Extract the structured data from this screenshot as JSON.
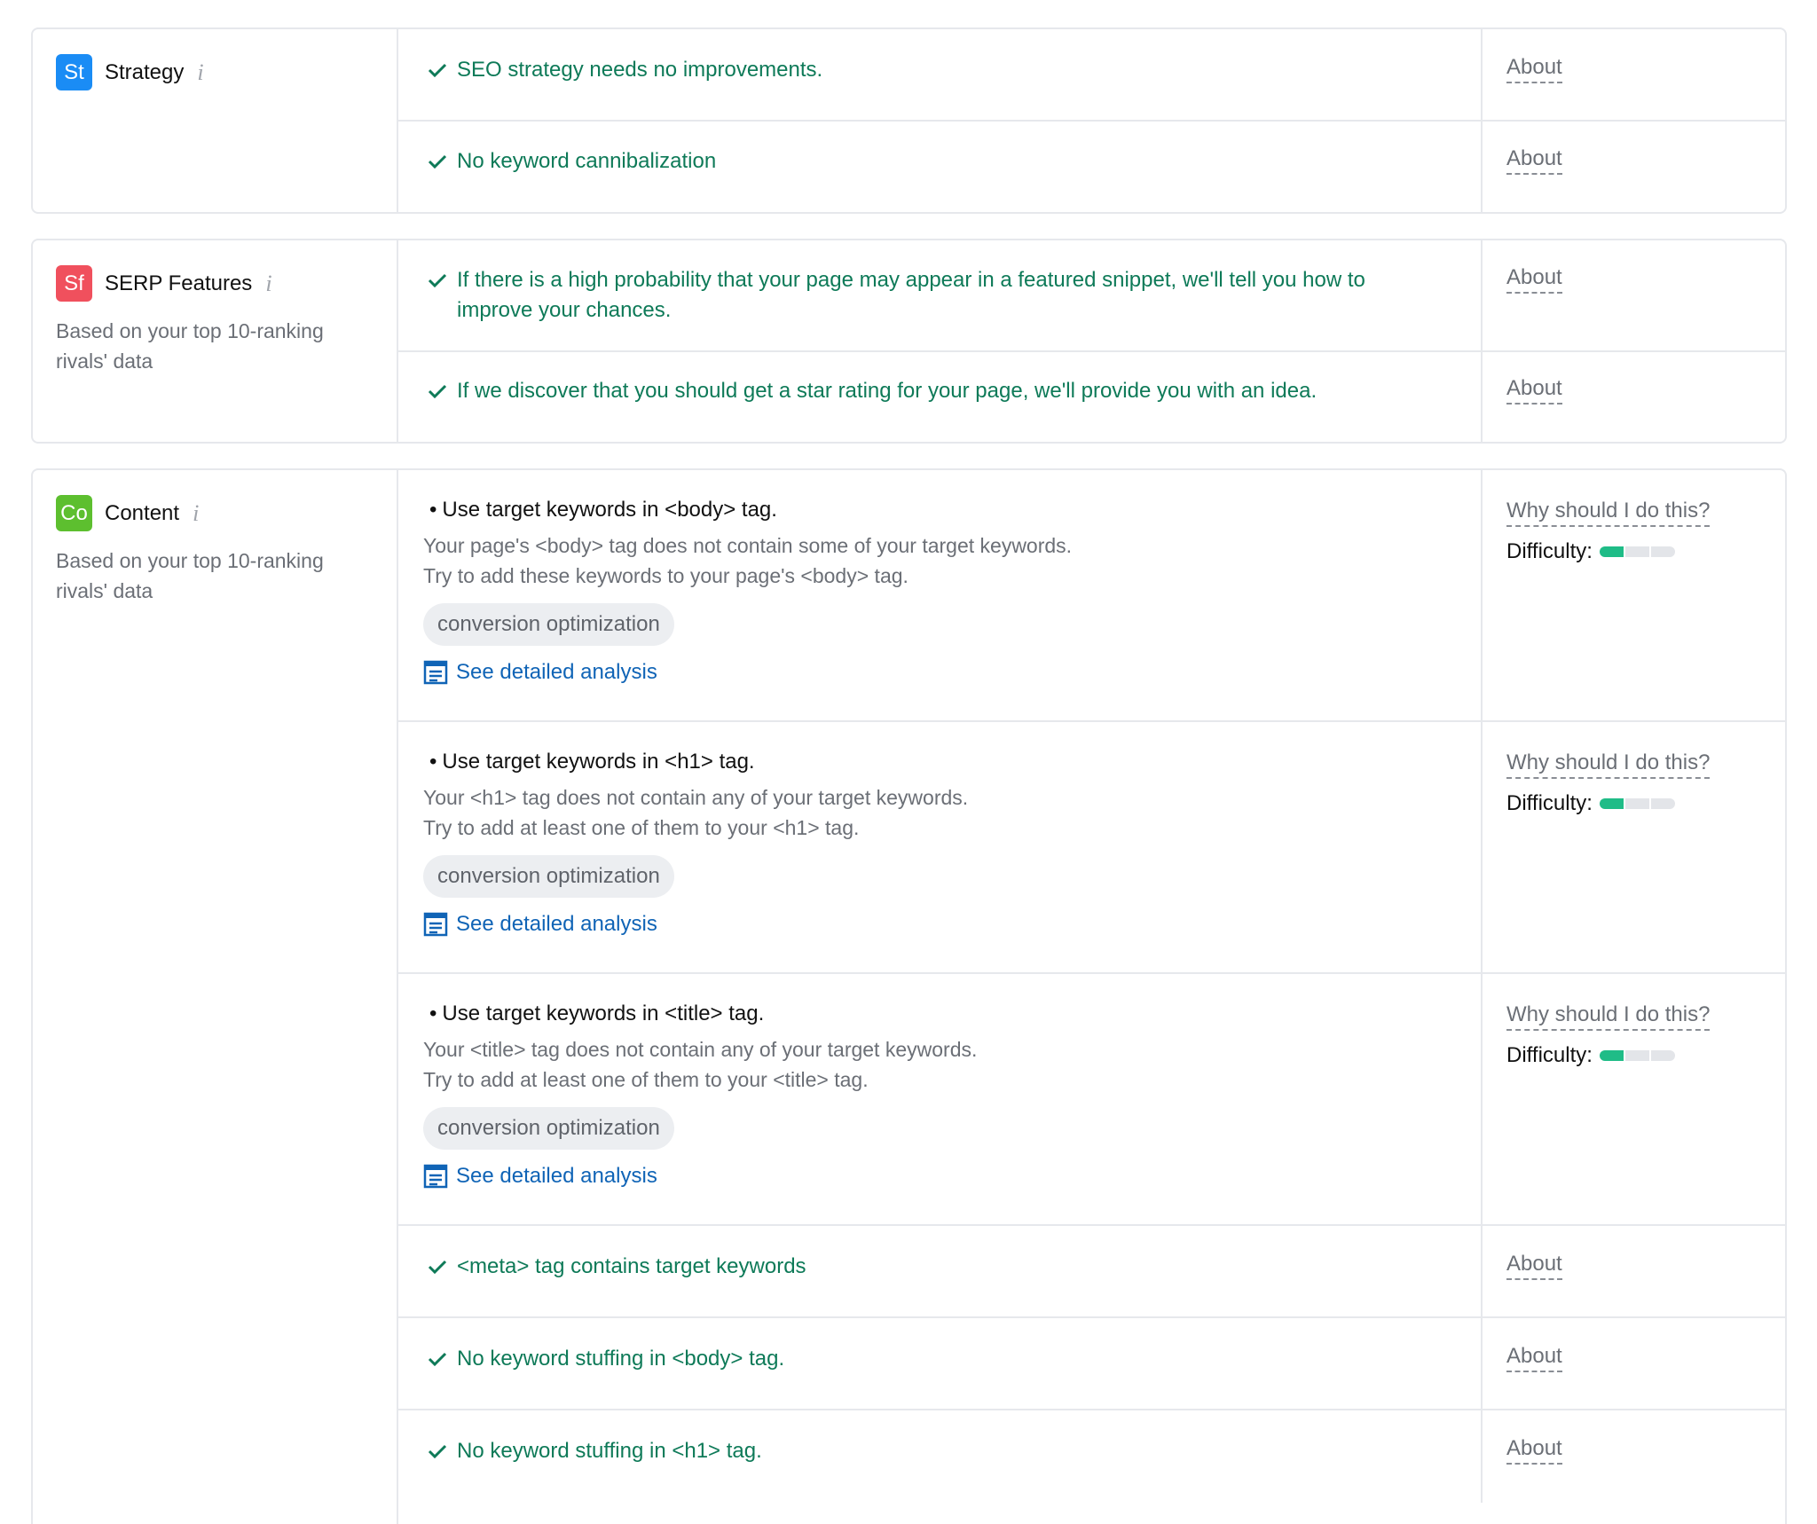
{
  "colors": {
    "strategy_badge": "#1a8cf5",
    "serp_badge": "#f0505d",
    "content_badge": "#5dbf2f",
    "success_text": "#0e7a58",
    "link_blue": "#1064b6",
    "difficulty_fill": "#1fbc87"
  },
  "strategy": {
    "badge": "St",
    "title": "Strategy",
    "info_icon": "i",
    "rows": [
      {
        "text": "SEO strategy needs no improvements.",
        "link": "About"
      },
      {
        "text": "No keyword cannibalization",
        "link": "About"
      }
    ]
  },
  "serp": {
    "badge": "Sf",
    "title": "SERP Features",
    "info_icon": "i",
    "subtitle": "Based on your top 10-ranking rivals' data",
    "rows": [
      {
        "text": "If there is a high probability that your page may appear in a featured snippet, we'll tell you how to improve your chances.",
        "link": "About"
      },
      {
        "text": "If we discover that you should get a star rating for your page, we'll provide you with an idea.",
        "link": "About"
      }
    ]
  },
  "content": {
    "badge": "Co",
    "title": "Content",
    "info_icon": "i",
    "subtitle": "Based on your top 10-ranking rivals' data",
    "tasks": [
      {
        "bullet": "•",
        "title": "Use target keywords in <body> tag.",
        "desc1": "Your page's <body> tag does not contain some of your target keywords.",
        "desc2": "Try to add these keywords to your page's <body> tag.",
        "tag": "conversion optimization",
        "analysis": "See detailed analysis",
        "why": "Why should I do this?",
        "difficulty_label": "Difficulty:",
        "difficulty_level": 1,
        "difficulty_max": 3
      },
      {
        "bullet": "•",
        "title": "Use target keywords in <h1> tag.",
        "desc1": "Your <h1> tag does not contain any of your target keywords.",
        "desc2": "Try to add at least one of them to your <h1> tag.",
        "tag": "conversion optimization",
        "analysis": "See detailed analysis",
        "why": "Why should I do this?",
        "difficulty_label": "Difficulty:",
        "difficulty_level": 1,
        "difficulty_max": 3
      },
      {
        "bullet": "•",
        "title": "Use target keywords in <title> tag.",
        "desc1": "Your <title> tag does not contain any of your target keywords.",
        "desc2": "Try to add at least one of them to your <title> tag.",
        "tag": "conversion optimization",
        "analysis": "See detailed analysis",
        "why": "Why should I do this?",
        "difficulty_label": "Difficulty:",
        "difficulty_level": 1,
        "difficulty_max": 3
      }
    ],
    "rows": [
      {
        "text": "<meta> tag contains target keywords",
        "link": "About"
      },
      {
        "text": "No keyword stuffing in <body> tag.",
        "link": "About"
      },
      {
        "text": "No keyword stuffing in <h1> tag.",
        "link": "About"
      }
    ]
  }
}
